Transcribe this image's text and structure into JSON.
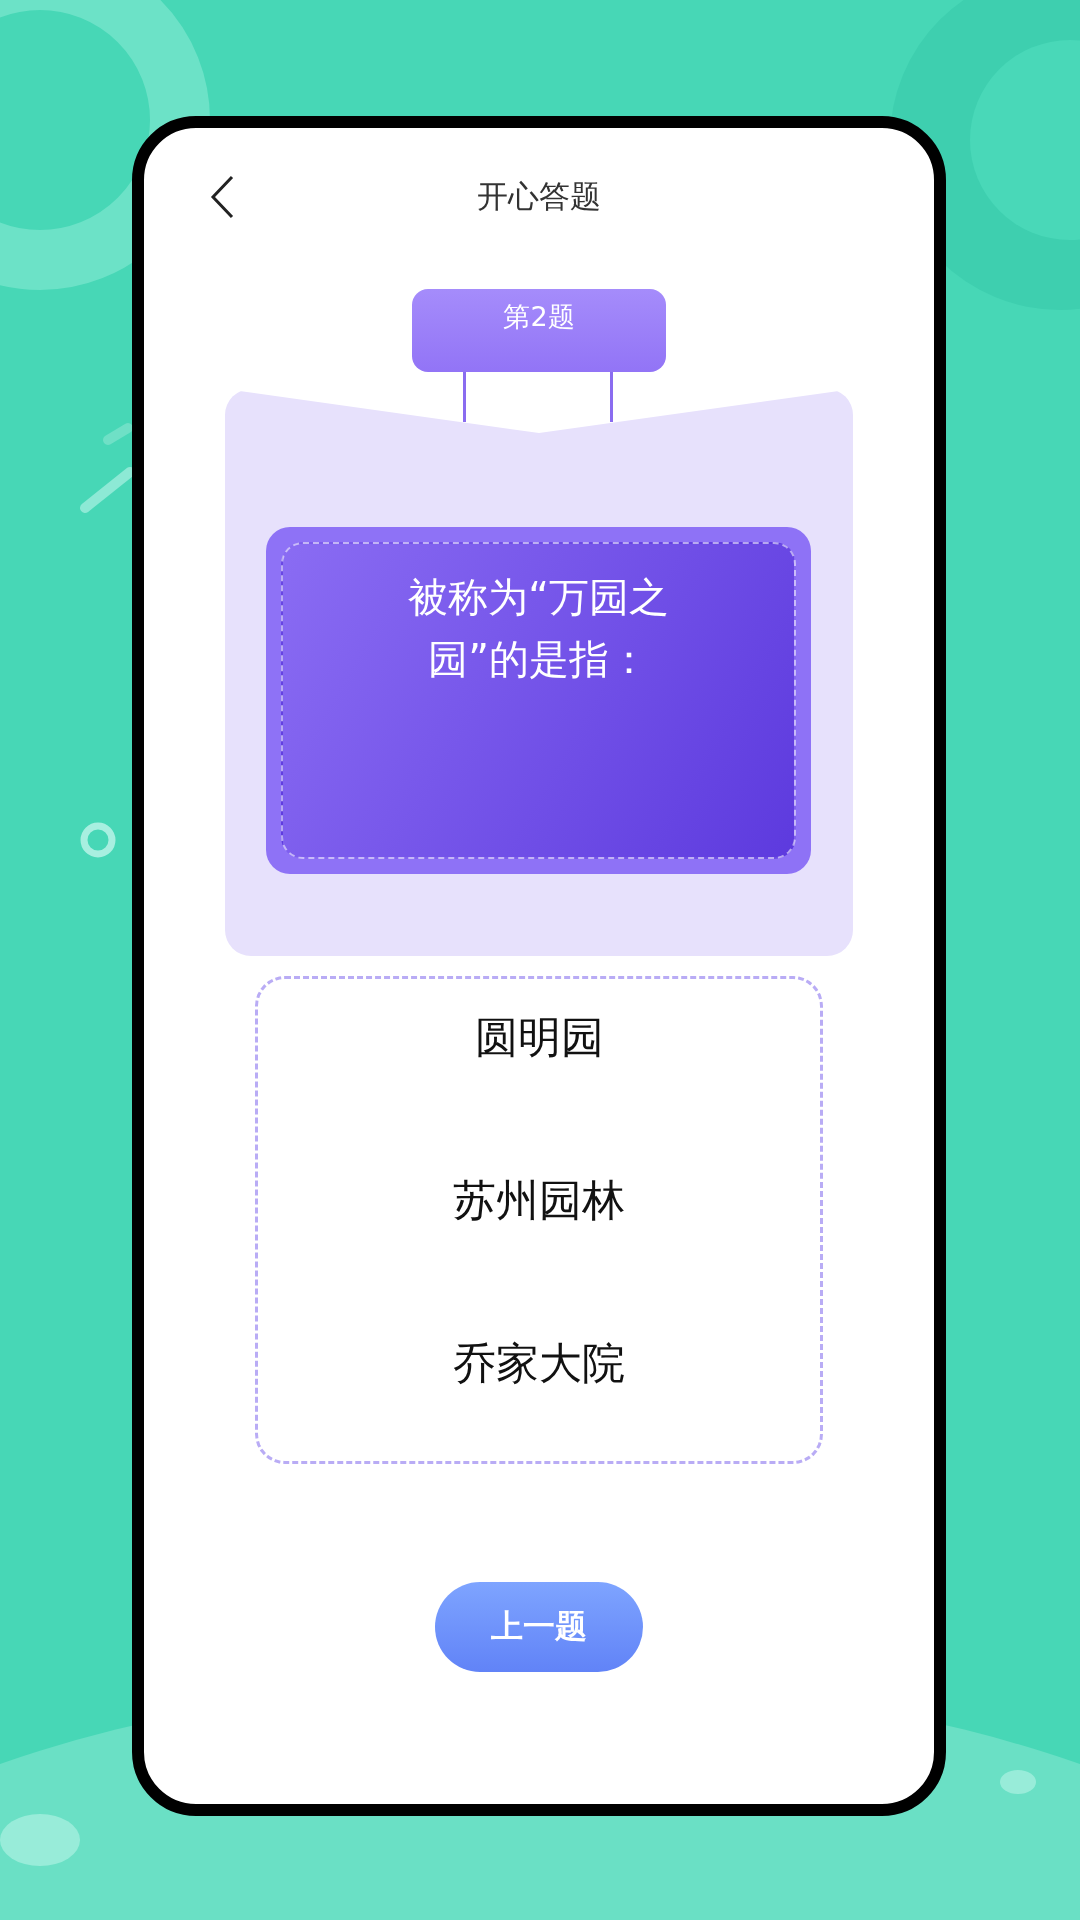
{
  "header": {
    "title": "开心答题"
  },
  "question": {
    "number_tag": "第2题",
    "text": "被称为“万园之园”的是指："
  },
  "options": [
    {
      "label": "圆明园",
      "selected": false
    },
    {
      "label": "苏州园林",
      "selected": false
    },
    {
      "label": "乔家大院",
      "selected": false
    }
  ],
  "prev_button": {
    "label": "上一题"
  }
}
